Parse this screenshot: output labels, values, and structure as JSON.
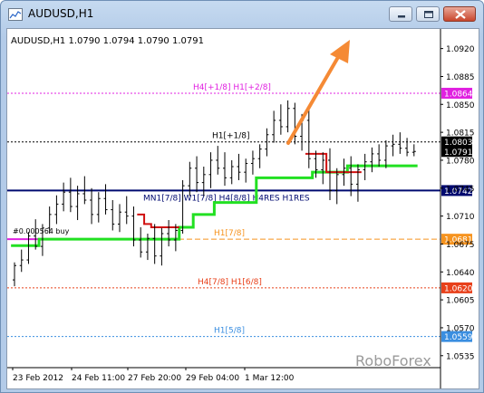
{
  "window": {
    "title": "AUDUSD,H1"
  },
  "header": {
    "ohlc": "AUDUSD,H1  1.0790 1.0794 1.0790 1.0791"
  },
  "watermark": "RoboForex",
  "colors": {
    "magenta": "#e020e0",
    "navy": "#000a70",
    "orange": "#f6931e",
    "red_orange": "#e8401a",
    "blue": "#3a8ee0",
    "green": "#22e022",
    "red": "#d01010",
    "price_bg": "#000000",
    "price_prev_bg": "#3c3c3c",
    "arrow": "#f58a35"
  },
  "chart_data": {
    "type": "candlestick",
    "ylim": [
      1.052,
      1.094
    ],
    "y_ticks": [
      "1.0920",
      "1.0885",
      "1.0850",
      "1.0815",
      "1.0780",
      "1.0745",
      "1.0710",
      "1.0675",
      "1.0640",
      "1.0605",
      "1.0570",
      "1.0535"
    ],
    "x_ticks": [
      "23 Feb 2012",
      "24 Feb 11:00",
      "27 Feb 20:00",
      "29 Feb 04:00",
      "1 Mar 12:00"
    ],
    "levels": [
      {
        "label": "H4[+1/8] H1[+2/8]",
        "value": 1.0864,
        "tag": "1.0864",
        "color": "magenta",
        "style": "dotted"
      },
      {
        "label": "H1[+1/8]",
        "value": 1.0803,
        "tag": "1.0803",
        "color": "black",
        "style": "dotted"
      },
      {
        "label": "MN1[7/8] W1[7/8] H4[8/8] H4RES H1RES",
        "value": 1.0742,
        "tag": "1.0742",
        "color": "navy",
        "style": "solid"
      },
      {
        "label": "H1[7/8]",
        "value": 1.0681,
        "tag": "1.0681",
        "color": "orange",
        "style": "dashed"
      },
      {
        "label": "H4[7/8] H1[6/8]",
        "value": 1.062,
        "tag": "1.0620",
        "color": "red_orange",
        "style": "dotted"
      },
      {
        "label": "H1[5/8]",
        "value": 1.0559,
        "tag": "1.0559",
        "color": "blue",
        "style": "dotted"
      }
    ],
    "current_price": "1.0791",
    "order_label": "#0.000564 buy",
    "order_value": 1.0681,
    "bars": [
      [
        1.063,
        1.0652,
        1.0622,
        1.0648
      ],
      [
        1.0648,
        1.0668,
        1.064,
        1.0655
      ],
      [
        1.0655,
        1.069,
        1.065,
        1.0685
      ],
      [
        1.0685,
        1.0706,
        1.0668,
        1.0672
      ],
      [
        1.0672,
        1.07,
        1.066,
        1.0695
      ],
      [
        1.0695,
        1.0722,
        1.0688,
        1.0712
      ],
      [
        1.0712,
        1.0736,
        1.07,
        1.0725
      ],
      [
        1.0725,
        1.0752,
        1.0716,
        1.074
      ],
      [
        1.074,
        1.0758,
        1.0715,
        1.0722
      ],
      [
        1.0722,
        1.0748,
        1.0705,
        1.0738
      ],
      [
        1.0738,
        1.076,
        1.0725,
        1.073
      ],
      [
        1.073,
        1.0745,
        1.07,
        1.0712
      ],
      [
        1.0712,
        1.074,
        1.0702,
        1.0732
      ],
      [
        1.0732,
        1.075,
        1.0712,
        1.0718
      ],
      [
        1.0718,
        1.073,
        1.0692,
        1.07
      ],
      [
        1.07,
        1.0725,
        1.069,
        1.0715
      ],
      [
        1.0715,
        1.0735,
        1.07,
        1.071
      ],
      [
        1.071,
        1.0722,
        1.0672,
        1.068
      ],
      [
        1.068,
        1.0696,
        1.0658,
        1.0665
      ],
      [
        1.0665,
        1.0688,
        1.0655,
        1.0682
      ],
      [
        1.0682,
        1.07,
        1.065,
        1.066
      ],
      [
        1.066,
        1.0695,
        1.0648,
        1.0688
      ],
      [
        1.0688,
        1.0705,
        1.0672,
        1.068
      ],
      [
        1.068,
        1.07,
        1.0666,
        1.0692
      ],
      [
        1.0692,
        1.0755,
        1.0688,
        1.0748
      ],
      [
        1.0748,
        1.0778,
        1.0735,
        1.077
      ],
      [
        1.077,
        1.0785,
        1.074,
        1.0752
      ],
      [
        1.0752,
        1.0772,
        1.0735,
        1.0762
      ],
      [
        1.0762,
        1.079,
        1.0745,
        1.078
      ],
      [
        1.078,
        1.0798,
        1.0762,
        1.077
      ],
      [
        1.077,
        1.079,
        1.0748,
        1.0758
      ],
      [
        1.0758,
        1.078,
        1.075,
        1.0772
      ],
      [
        1.0772,
        1.0788,
        1.0755,
        1.0765
      ],
      [
        1.0765,
        1.0782,
        1.0752,
        1.0776
      ],
      [
        1.0776,
        1.0792,
        1.0762,
        1.0782
      ],
      [
        1.0782,
        1.08,
        1.077,
        1.0794
      ],
      [
        1.0794,
        1.082,
        1.0785,
        1.0812
      ],
      [
        1.0812,
        1.0842,
        1.0802,
        1.083
      ],
      [
        1.083,
        1.085,
        1.0812,
        1.0822
      ],
      [
        1.0822,
        1.0855,
        1.0815,
        1.0845
      ],
      [
        1.0845,
        1.0852,
        1.08,
        1.081
      ],
      [
        1.081,
        1.0838,
        1.0792,
        1.083
      ],
      [
        1.083,
        1.0845,
        1.077,
        1.0782
      ],
      [
        1.0782,
        1.0792,
        1.0758,
        1.0768
      ],
      [
        1.0768,
        1.079,
        1.075,
        1.078
      ],
      [
        1.078,
        1.0795,
        1.073,
        1.0742
      ],
      [
        1.0742,
        1.077,
        1.0725,
        1.0762
      ],
      [
        1.0762,
        1.0782,
        1.0748,
        1.077
      ],
      [
        1.077,
        1.0785,
        1.0735,
        1.075
      ],
      [
        1.075,
        1.0775,
        1.0728,
        1.0768
      ],
      [
        1.0768,
        1.0788,
        1.0755,
        1.0778
      ],
      [
        1.0778,
        1.0796,
        1.0765,
        1.0788
      ],
      [
        1.0788,
        1.08,
        1.0772,
        1.078
      ],
      [
        1.078,
        1.0805,
        1.077,
        1.0798
      ],
      [
        1.0798,
        1.0812,
        1.0785,
        1.08
      ],
      [
        1.08,
        1.0815,
        1.0788,
        1.0795
      ],
      [
        1.0795,
        1.0808,
        1.0785,
        1.079
      ],
      [
        1.079,
        1.08,
        1.0785,
        1.0791
      ]
    ],
    "green_line": [
      1.0673,
      1.0673,
      1.0673,
      1.0673,
      1.0681,
      1.0681,
      1.0681,
      1.0681,
      1.0681,
      1.0681,
      1.0681,
      1.0681,
      1.0681,
      1.0681,
      1.0681,
      1.0681,
      1.0681,
      1.0681,
      1.0681,
      1.0681,
      1.0681,
      1.0681,
      1.0681,
      1.0681,
      1.0696,
      1.0696,
      1.0712,
      1.0712,
      1.0712,
      1.0727,
      1.0727,
      1.0727,
      1.0727,
      1.0727,
      1.0727,
      1.0758,
      1.0758,
      1.0758,
      1.0758,
      1.0758,
      1.0758,
      1.0758,
      1.0758,
      1.0765,
      1.0765,
      1.0765,
      1.0765,
      1.0765,
      1.0773,
      1.0773,
      1.0773,
      1.0773,
      1.0773,
      1.0773,
      1.0773,
      1.0773,
      1.0773,
      1.0773
    ],
    "red_line": [
      null,
      null,
      null,
      null,
      null,
      null,
      null,
      null,
      null,
      null,
      null,
      null,
      null,
      null,
      null,
      null,
      null,
      null,
      1.0712,
      1.07,
      1.0696,
      1.0696,
      1.0696,
      1.0696,
      null,
      null,
      null,
      null,
      null,
      null,
      null,
      null,
      null,
      null,
      null,
      null,
      null,
      null,
      null,
      null,
      null,
      null,
      1.0788,
      1.0788,
      1.0788,
      1.0765,
      1.0765,
      1.0765,
      1.0765,
      1.0765,
      null,
      null,
      null,
      null,
      null,
      null,
      null,
      null
    ]
  }
}
